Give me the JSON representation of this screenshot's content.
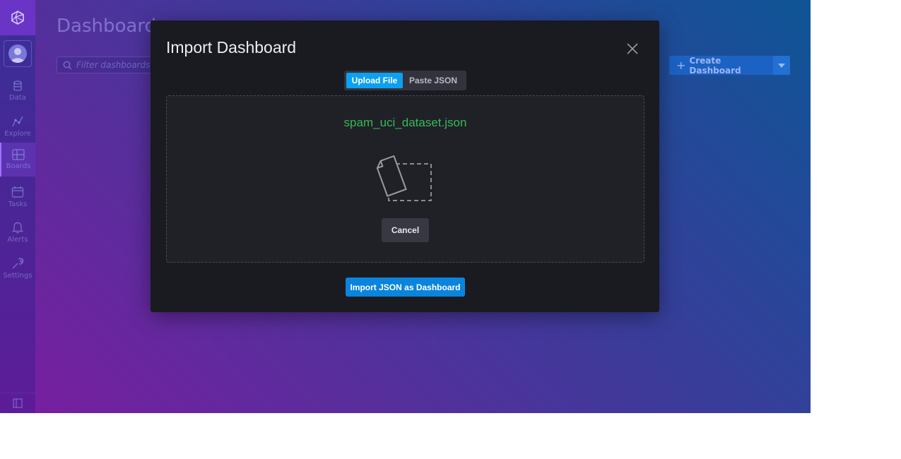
{
  "sidebar": {
    "items": [
      {
        "label": "Data",
        "icon": "database-icon"
      },
      {
        "label": "Explore",
        "icon": "graph-icon"
      },
      {
        "label": "Boards",
        "icon": "dashboard-grid-icon",
        "active": true
      },
      {
        "label": "Tasks",
        "icon": "calendar-icon"
      },
      {
        "label": "Alerts",
        "icon": "bell-icon"
      },
      {
        "label": "Settings",
        "icon": "wrench-icon"
      }
    ]
  },
  "page": {
    "title": "Dashboards",
    "filter_placeholder": "Filter dashboards...",
    "create_label": "Create Dashboard"
  },
  "modal": {
    "title": "Import Dashboard",
    "tabs": [
      {
        "label": "Upload File",
        "active": true
      },
      {
        "label": "Paste JSON",
        "active": false
      }
    ],
    "file_name": "spam_uci_dataset.json",
    "cancel_label": "Cancel",
    "import_label": "Import JSON as Dashboard"
  },
  "colors": {
    "accent_blue": "#0ca0f0",
    "file_name_green": "#34bb55",
    "modal_bg": "#1a1a21"
  }
}
